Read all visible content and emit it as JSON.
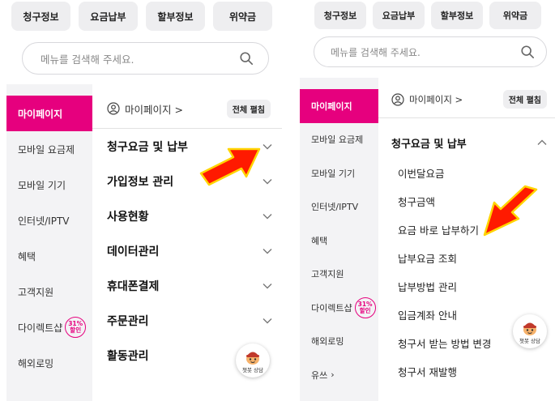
{
  "quick_menu": [
    "청구정보",
    "요금납부",
    "할부정보",
    "위약금"
  ],
  "search": {
    "placeholder": "메뉴를 검색해 주세요."
  },
  "sidebar": {
    "items": [
      "마이페이지",
      "모바일 요금제",
      "모바일 기기",
      "인터넷/IPTV",
      "혜택",
      "고객지원",
      "다이렉트샵",
      "해외로밍",
      "유쓰"
    ],
    "badge": {
      "percent": "31%",
      "text": "할인"
    },
    "more_chevron": "›"
  },
  "main": {
    "mypage_link": "마이페이지 >",
    "expand_all": "전체 펼침",
    "categories": [
      "청구요금 및 납부",
      "가입정보 관리",
      "사용현황",
      "데이터관리",
      "휴대폰결제",
      "주문관리",
      "활동관리"
    ],
    "billing_sub": [
      "이번달요금",
      "청구금액",
      "요금 바로 납부하기",
      "납부요금 조회",
      "납부방법 관리",
      "입금계좌 안내",
      "청구서 받는 방법 변경",
      "청구서 재발행"
    ]
  },
  "chatbot": {
    "label": "챗봇 상담"
  },
  "colors": {
    "accent": "#e6007e",
    "arrow": "#ff1a00",
    "arrow_border": "#ffd400"
  }
}
